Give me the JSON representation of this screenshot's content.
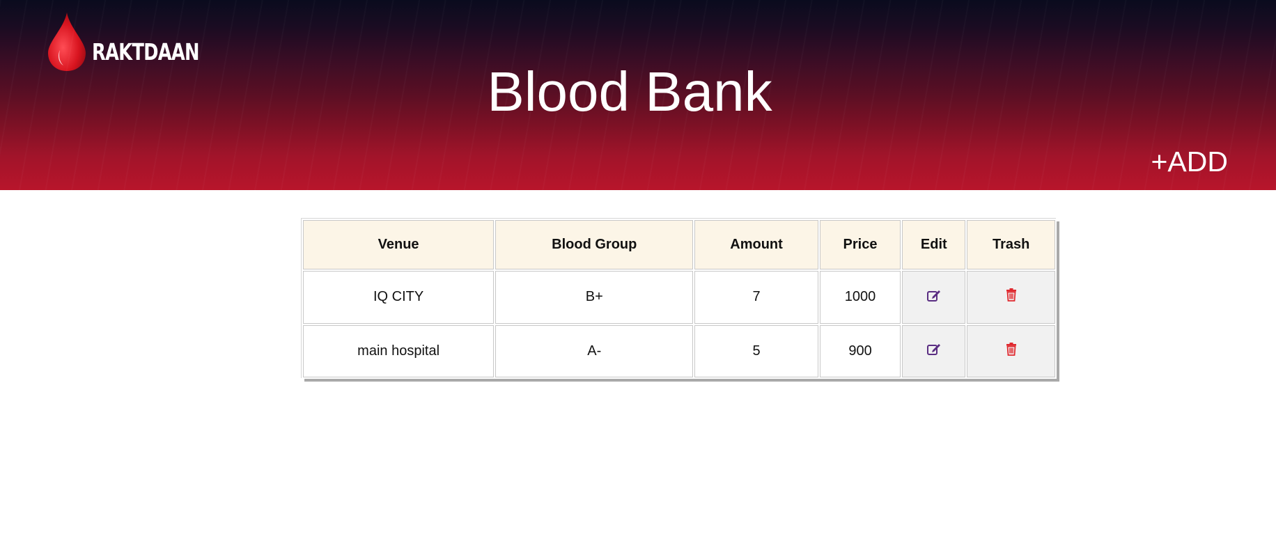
{
  "header": {
    "logo_text": "RAKTDAAN",
    "title": "Blood Bank",
    "add_label": "+ADD"
  },
  "table": {
    "columns": [
      "Venue",
      "Blood Group",
      "Amount",
      "Price",
      "Edit",
      "Trash"
    ],
    "rows": [
      {
        "venue": "IQ CITY",
        "blood_group": "B+",
        "amount": "7",
        "price": "1000"
      },
      {
        "venue": "main hospital",
        "blood_group": "A-",
        "amount": "5",
        "price": "900"
      }
    ]
  },
  "icons": {
    "logo": "blood-drop-icon",
    "edit": "edit-icon",
    "trash": "trash-icon"
  },
  "colors": {
    "edit_icon": "#5a2d82",
    "trash_icon": "#e0282e",
    "header_row": "#fcf5e7",
    "action_cell": "#f1f1f1"
  }
}
